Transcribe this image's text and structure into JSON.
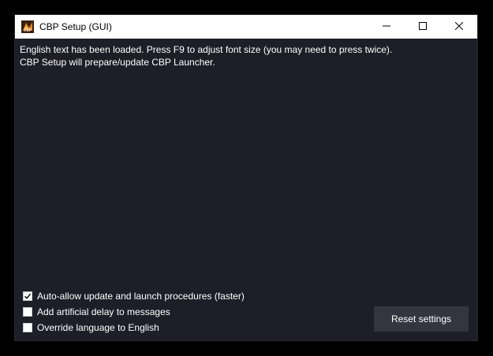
{
  "window": {
    "title": "CBP Setup (GUI)",
    "controls": {
      "minimize": "minimize",
      "maximize": "maximize",
      "close": "close"
    }
  },
  "log": {
    "lines": [
      "English text has been loaded. Press F9 to adjust font size (you may need to press twice).",
      "CBP Setup will prepare/update CBP Launcher."
    ]
  },
  "options": [
    {
      "label": "Auto-allow update and launch procedures (faster)",
      "checked": true
    },
    {
      "label": "Add artificial delay to messages",
      "checked": false
    },
    {
      "label": "Override language to English",
      "checked": false
    }
  ],
  "buttons": {
    "reset": "Reset settings"
  },
  "colors": {
    "background": "#1e1e28",
    "titlebar": "#ffffff",
    "button": "#353540",
    "text": "#ffffff"
  },
  "icons": {
    "app": "cbp-app-icon",
    "minimize": "minimize-icon",
    "maximize": "maximize-icon",
    "close": "close-icon",
    "check": "checkmark-icon"
  }
}
